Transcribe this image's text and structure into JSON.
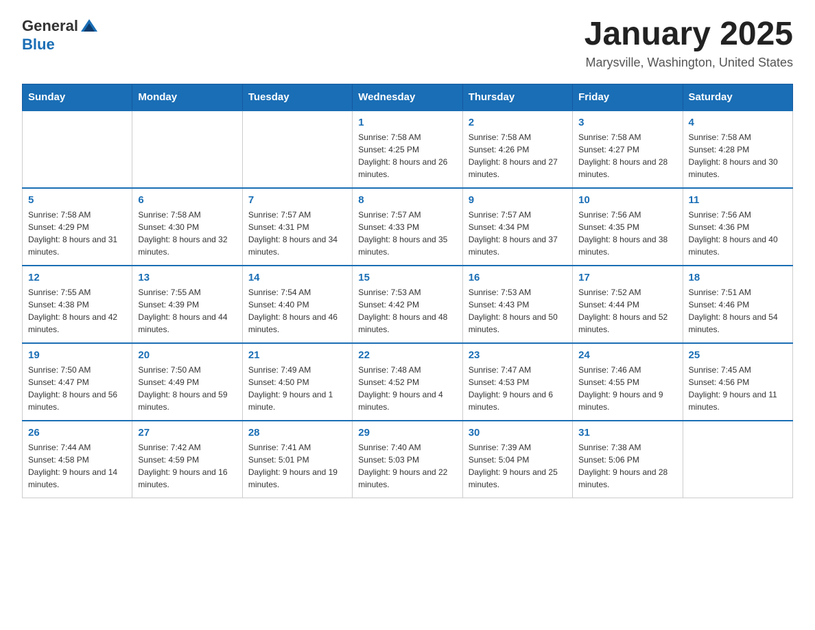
{
  "logo": {
    "text_general": "General",
    "text_blue": "Blue"
  },
  "header": {
    "title": "January 2025",
    "subtitle": "Marysville, Washington, United States"
  },
  "days_of_week": [
    "Sunday",
    "Monday",
    "Tuesday",
    "Wednesday",
    "Thursday",
    "Friday",
    "Saturday"
  ],
  "weeks": [
    [
      {
        "day": "",
        "info": ""
      },
      {
        "day": "",
        "info": ""
      },
      {
        "day": "",
        "info": ""
      },
      {
        "day": "1",
        "info": "Sunrise: 7:58 AM\nSunset: 4:25 PM\nDaylight: 8 hours and 26 minutes."
      },
      {
        "day": "2",
        "info": "Sunrise: 7:58 AM\nSunset: 4:26 PM\nDaylight: 8 hours and 27 minutes."
      },
      {
        "day": "3",
        "info": "Sunrise: 7:58 AM\nSunset: 4:27 PM\nDaylight: 8 hours and 28 minutes."
      },
      {
        "day": "4",
        "info": "Sunrise: 7:58 AM\nSunset: 4:28 PM\nDaylight: 8 hours and 30 minutes."
      }
    ],
    [
      {
        "day": "5",
        "info": "Sunrise: 7:58 AM\nSunset: 4:29 PM\nDaylight: 8 hours and 31 minutes."
      },
      {
        "day": "6",
        "info": "Sunrise: 7:58 AM\nSunset: 4:30 PM\nDaylight: 8 hours and 32 minutes."
      },
      {
        "day": "7",
        "info": "Sunrise: 7:57 AM\nSunset: 4:31 PM\nDaylight: 8 hours and 34 minutes."
      },
      {
        "day": "8",
        "info": "Sunrise: 7:57 AM\nSunset: 4:33 PM\nDaylight: 8 hours and 35 minutes."
      },
      {
        "day": "9",
        "info": "Sunrise: 7:57 AM\nSunset: 4:34 PM\nDaylight: 8 hours and 37 minutes."
      },
      {
        "day": "10",
        "info": "Sunrise: 7:56 AM\nSunset: 4:35 PM\nDaylight: 8 hours and 38 minutes."
      },
      {
        "day": "11",
        "info": "Sunrise: 7:56 AM\nSunset: 4:36 PM\nDaylight: 8 hours and 40 minutes."
      }
    ],
    [
      {
        "day": "12",
        "info": "Sunrise: 7:55 AM\nSunset: 4:38 PM\nDaylight: 8 hours and 42 minutes."
      },
      {
        "day": "13",
        "info": "Sunrise: 7:55 AM\nSunset: 4:39 PM\nDaylight: 8 hours and 44 minutes."
      },
      {
        "day": "14",
        "info": "Sunrise: 7:54 AM\nSunset: 4:40 PM\nDaylight: 8 hours and 46 minutes."
      },
      {
        "day": "15",
        "info": "Sunrise: 7:53 AM\nSunset: 4:42 PM\nDaylight: 8 hours and 48 minutes."
      },
      {
        "day": "16",
        "info": "Sunrise: 7:53 AM\nSunset: 4:43 PM\nDaylight: 8 hours and 50 minutes."
      },
      {
        "day": "17",
        "info": "Sunrise: 7:52 AM\nSunset: 4:44 PM\nDaylight: 8 hours and 52 minutes."
      },
      {
        "day": "18",
        "info": "Sunrise: 7:51 AM\nSunset: 4:46 PM\nDaylight: 8 hours and 54 minutes."
      }
    ],
    [
      {
        "day": "19",
        "info": "Sunrise: 7:50 AM\nSunset: 4:47 PM\nDaylight: 8 hours and 56 minutes."
      },
      {
        "day": "20",
        "info": "Sunrise: 7:50 AM\nSunset: 4:49 PM\nDaylight: 8 hours and 59 minutes."
      },
      {
        "day": "21",
        "info": "Sunrise: 7:49 AM\nSunset: 4:50 PM\nDaylight: 9 hours and 1 minute."
      },
      {
        "day": "22",
        "info": "Sunrise: 7:48 AM\nSunset: 4:52 PM\nDaylight: 9 hours and 4 minutes."
      },
      {
        "day": "23",
        "info": "Sunrise: 7:47 AM\nSunset: 4:53 PM\nDaylight: 9 hours and 6 minutes."
      },
      {
        "day": "24",
        "info": "Sunrise: 7:46 AM\nSunset: 4:55 PM\nDaylight: 9 hours and 9 minutes."
      },
      {
        "day": "25",
        "info": "Sunrise: 7:45 AM\nSunset: 4:56 PM\nDaylight: 9 hours and 11 minutes."
      }
    ],
    [
      {
        "day": "26",
        "info": "Sunrise: 7:44 AM\nSunset: 4:58 PM\nDaylight: 9 hours and 14 minutes."
      },
      {
        "day": "27",
        "info": "Sunrise: 7:42 AM\nSunset: 4:59 PM\nDaylight: 9 hours and 16 minutes."
      },
      {
        "day": "28",
        "info": "Sunrise: 7:41 AM\nSunset: 5:01 PM\nDaylight: 9 hours and 19 minutes."
      },
      {
        "day": "29",
        "info": "Sunrise: 7:40 AM\nSunset: 5:03 PM\nDaylight: 9 hours and 22 minutes."
      },
      {
        "day": "30",
        "info": "Sunrise: 7:39 AM\nSunset: 5:04 PM\nDaylight: 9 hours and 25 minutes."
      },
      {
        "day": "31",
        "info": "Sunrise: 7:38 AM\nSunset: 5:06 PM\nDaylight: 9 hours and 28 minutes."
      },
      {
        "day": "",
        "info": ""
      }
    ]
  ]
}
